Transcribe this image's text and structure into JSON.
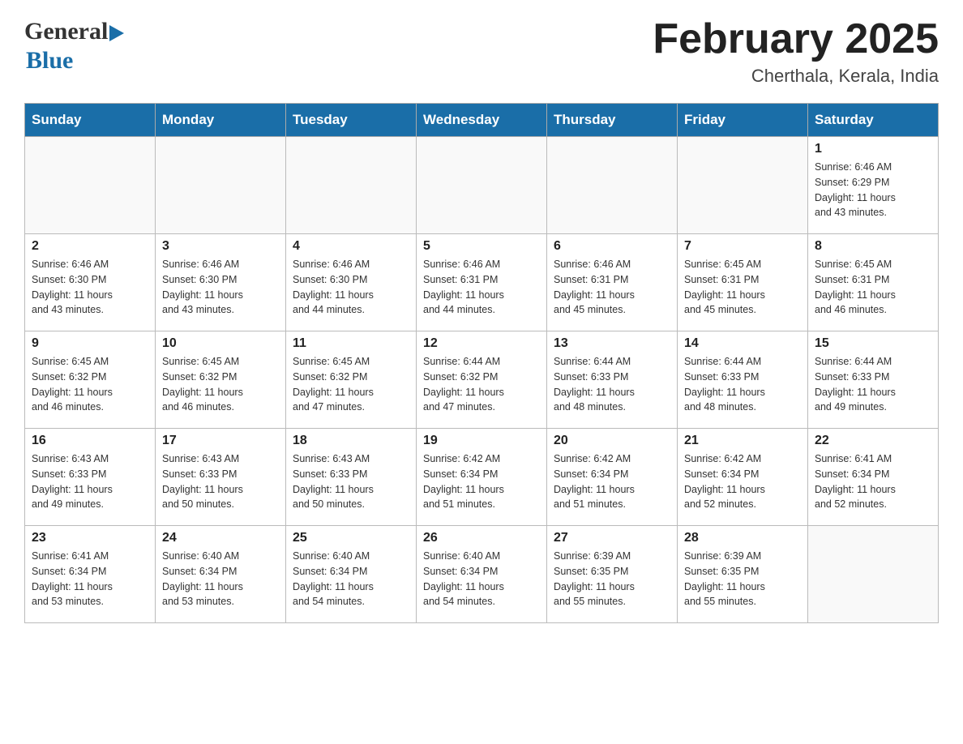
{
  "header": {
    "logo": {
      "general": "General",
      "blue": "Blue",
      "arrow": "▶"
    },
    "title": "February 2025",
    "location": "Cherthala, Kerala, India"
  },
  "days_of_week": [
    "Sunday",
    "Monday",
    "Tuesday",
    "Wednesday",
    "Thursday",
    "Friday",
    "Saturday"
  ],
  "weeks": [
    [
      {
        "day": "",
        "info": ""
      },
      {
        "day": "",
        "info": ""
      },
      {
        "day": "",
        "info": ""
      },
      {
        "day": "",
        "info": ""
      },
      {
        "day": "",
        "info": ""
      },
      {
        "day": "",
        "info": ""
      },
      {
        "day": "1",
        "info": "Sunrise: 6:46 AM\nSunset: 6:29 PM\nDaylight: 11 hours\nand 43 minutes."
      }
    ],
    [
      {
        "day": "2",
        "info": "Sunrise: 6:46 AM\nSunset: 6:30 PM\nDaylight: 11 hours\nand 43 minutes."
      },
      {
        "day": "3",
        "info": "Sunrise: 6:46 AM\nSunset: 6:30 PM\nDaylight: 11 hours\nand 43 minutes."
      },
      {
        "day": "4",
        "info": "Sunrise: 6:46 AM\nSunset: 6:30 PM\nDaylight: 11 hours\nand 44 minutes."
      },
      {
        "day": "5",
        "info": "Sunrise: 6:46 AM\nSunset: 6:31 PM\nDaylight: 11 hours\nand 44 minutes."
      },
      {
        "day": "6",
        "info": "Sunrise: 6:46 AM\nSunset: 6:31 PM\nDaylight: 11 hours\nand 45 minutes."
      },
      {
        "day": "7",
        "info": "Sunrise: 6:45 AM\nSunset: 6:31 PM\nDaylight: 11 hours\nand 45 minutes."
      },
      {
        "day": "8",
        "info": "Sunrise: 6:45 AM\nSunset: 6:31 PM\nDaylight: 11 hours\nand 46 minutes."
      }
    ],
    [
      {
        "day": "9",
        "info": "Sunrise: 6:45 AM\nSunset: 6:32 PM\nDaylight: 11 hours\nand 46 minutes."
      },
      {
        "day": "10",
        "info": "Sunrise: 6:45 AM\nSunset: 6:32 PM\nDaylight: 11 hours\nand 46 minutes."
      },
      {
        "day": "11",
        "info": "Sunrise: 6:45 AM\nSunset: 6:32 PM\nDaylight: 11 hours\nand 47 minutes."
      },
      {
        "day": "12",
        "info": "Sunrise: 6:44 AM\nSunset: 6:32 PM\nDaylight: 11 hours\nand 47 minutes."
      },
      {
        "day": "13",
        "info": "Sunrise: 6:44 AM\nSunset: 6:33 PM\nDaylight: 11 hours\nand 48 minutes."
      },
      {
        "day": "14",
        "info": "Sunrise: 6:44 AM\nSunset: 6:33 PM\nDaylight: 11 hours\nand 48 minutes."
      },
      {
        "day": "15",
        "info": "Sunrise: 6:44 AM\nSunset: 6:33 PM\nDaylight: 11 hours\nand 49 minutes."
      }
    ],
    [
      {
        "day": "16",
        "info": "Sunrise: 6:43 AM\nSunset: 6:33 PM\nDaylight: 11 hours\nand 49 minutes."
      },
      {
        "day": "17",
        "info": "Sunrise: 6:43 AM\nSunset: 6:33 PM\nDaylight: 11 hours\nand 50 minutes."
      },
      {
        "day": "18",
        "info": "Sunrise: 6:43 AM\nSunset: 6:33 PM\nDaylight: 11 hours\nand 50 minutes."
      },
      {
        "day": "19",
        "info": "Sunrise: 6:42 AM\nSunset: 6:34 PM\nDaylight: 11 hours\nand 51 minutes."
      },
      {
        "day": "20",
        "info": "Sunrise: 6:42 AM\nSunset: 6:34 PM\nDaylight: 11 hours\nand 51 minutes."
      },
      {
        "day": "21",
        "info": "Sunrise: 6:42 AM\nSunset: 6:34 PM\nDaylight: 11 hours\nand 52 minutes."
      },
      {
        "day": "22",
        "info": "Sunrise: 6:41 AM\nSunset: 6:34 PM\nDaylight: 11 hours\nand 52 minutes."
      }
    ],
    [
      {
        "day": "23",
        "info": "Sunrise: 6:41 AM\nSunset: 6:34 PM\nDaylight: 11 hours\nand 53 minutes."
      },
      {
        "day": "24",
        "info": "Sunrise: 6:40 AM\nSunset: 6:34 PM\nDaylight: 11 hours\nand 53 minutes."
      },
      {
        "day": "25",
        "info": "Sunrise: 6:40 AM\nSunset: 6:34 PM\nDaylight: 11 hours\nand 54 minutes."
      },
      {
        "day": "26",
        "info": "Sunrise: 6:40 AM\nSunset: 6:34 PM\nDaylight: 11 hours\nand 54 minutes."
      },
      {
        "day": "27",
        "info": "Sunrise: 6:39 AM\nSunset: 6:35 PM\nDaylight: 11 hours\nand 55 minutes."
      },
      {
        "day": "28",
        "info": "Sunrise: 6:39 AM\nSunset: 6:35 PM\nDaylight: 11 hours\nand 55 minutes."
      },
      {
        "day": "",
        "info": ""
      }
    ]
  ]
}
